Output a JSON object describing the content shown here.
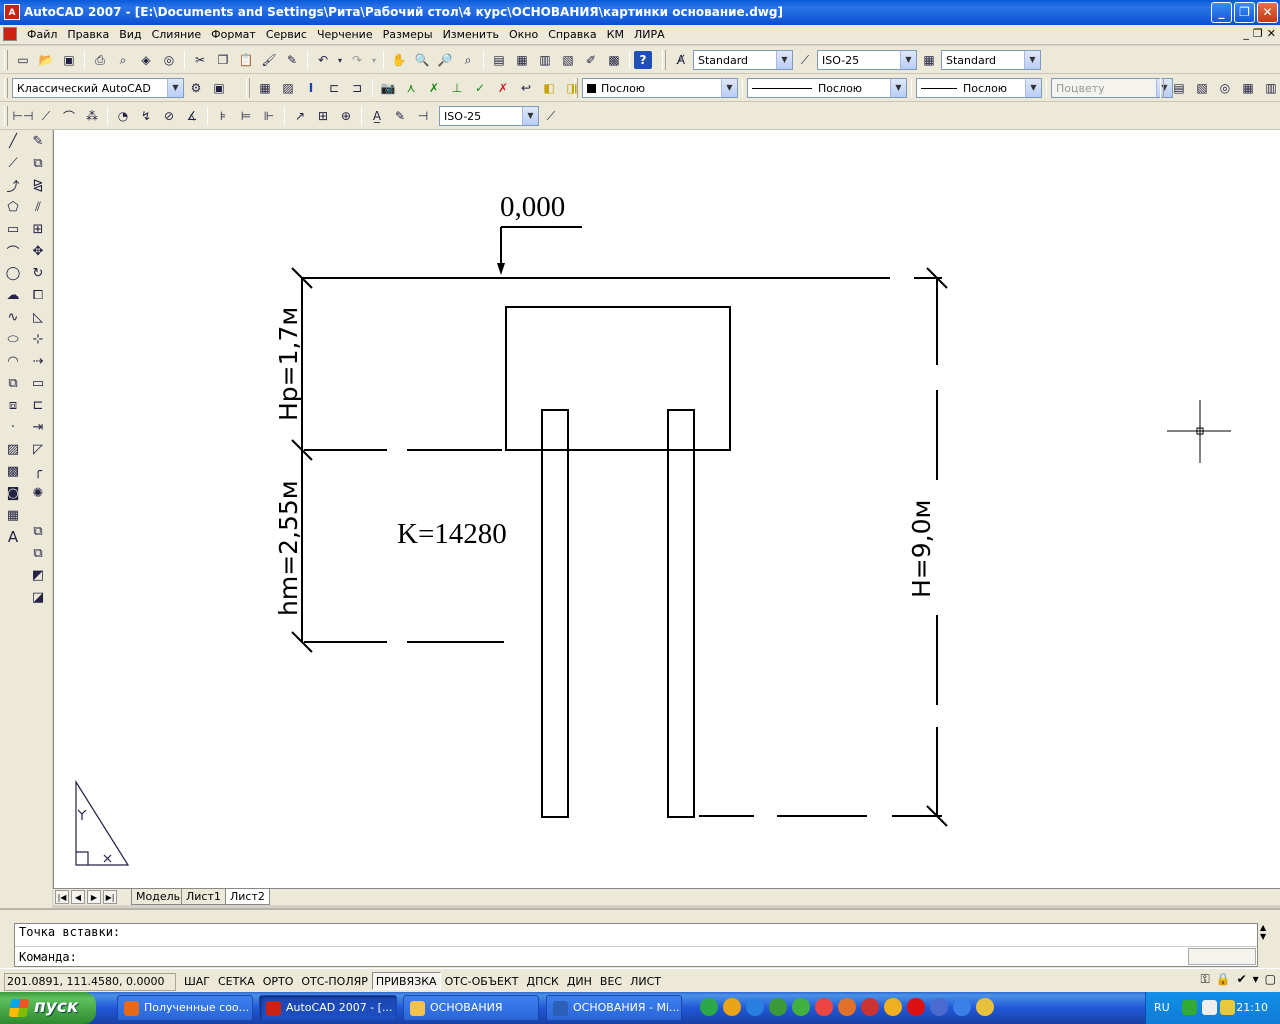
{
  "window": {
    "app_icon": "autocad-icon",
    "title": "AutoCAD 2007 - [E:\\Documents and Settings\\Рита\\Рабочий стол\\4 курс\\ОСНОВАНИЯ\\картинки основание.dwg]",
    "min": "_",
    "max": "❐",
    "close": "✕"
  },
  "menu": {
    "items": [
      "Файл",
      "Правка",
      "Вид",
      "Слияние",
      "Формат",
      "Сервис",
      "Черчение",
      "Размеры",
      "Изменить",
      "Окно",
      "Справка",
      "КМ",
      "ЛИРА"
    ],
    "mdi": [
      "_",
      "❐",
      "✕"
    ]
  },
  "toolbar1": {
    "text_style": "Standard",
    "dim_style": "ISO-25",
    "table_style": "Standard"
  },
  "toolbar2": {
    "workspace": "Классический AutoCAD",
    "layer_color": "Послою",
    "linetype": "Послою",
    "lineweight": "Послою",
    "plotstyle": "Поцвету"
  },
  "toolbar3": {
    "dim_style": "ISO-25"
  },
  "drawing": {
    "elevation_label": "0,000",
    "hp_label": "Hp=1,7м",
    "hm_label": "hm=2,55м",
    "h_label": "H=9,0м",
    "k_label": "K=14280"
  },
  "layout_tabs": [
    "Модель",
    "Лист1",
    "Лист2"
  ],
  "active_tab": "Лист2",
  "command": {
    "line1": "Точка вставки:",
    "line2": "Команда:"
  },
  "status": {
    "coords": "201.0891, 111.4580, 0.0000",
    "toggles": [
      {
        "label": "ШАГ",
        "on": false
      },
      {
        "label": "СЕТКА",
        "on": false
      },
      {
        "label": "ОРТО",
        "on": false
      },
      {
        "label": "ОТС-ПОЛЯР",
        "on": false
      },
      {
        "label": "ПРИВЯЗКА",
        "on": true
      },
      {
        "label": "ОТС-ОБЪЕКТ",
        "on": false
      },
      {
        "label": "ДПСК",
        "on": false
      },
      {
        "label": "ДИН",
        "on": false
      },
      {
        "label": "ВЕС",
        "on": false
      },
      {
        "label": "ЛИСТ",
        "on": false
      }
    ]
  },
  "taskbar": {
    "start": "пуск",
    "tasks": [
      {
        "label": "Полученные соо...",
        "icon_color": "#e66a1a"
      },
      {
        "label": "AutoCAD 2007 - [...",
        "icon_color": "#c21"
      },
      {
        "label": "ОСНОВАНИЯ",
        "icon_color": "#f2c14e"
      },
      {
        "label": "ОСНОВАНИЯ - Mi...",
        "icon_color": "#2b5fb8"
      }
    ],
    "active_task": 1,
    "lang": "RU",
    "clock": "21:10"
  }
}
